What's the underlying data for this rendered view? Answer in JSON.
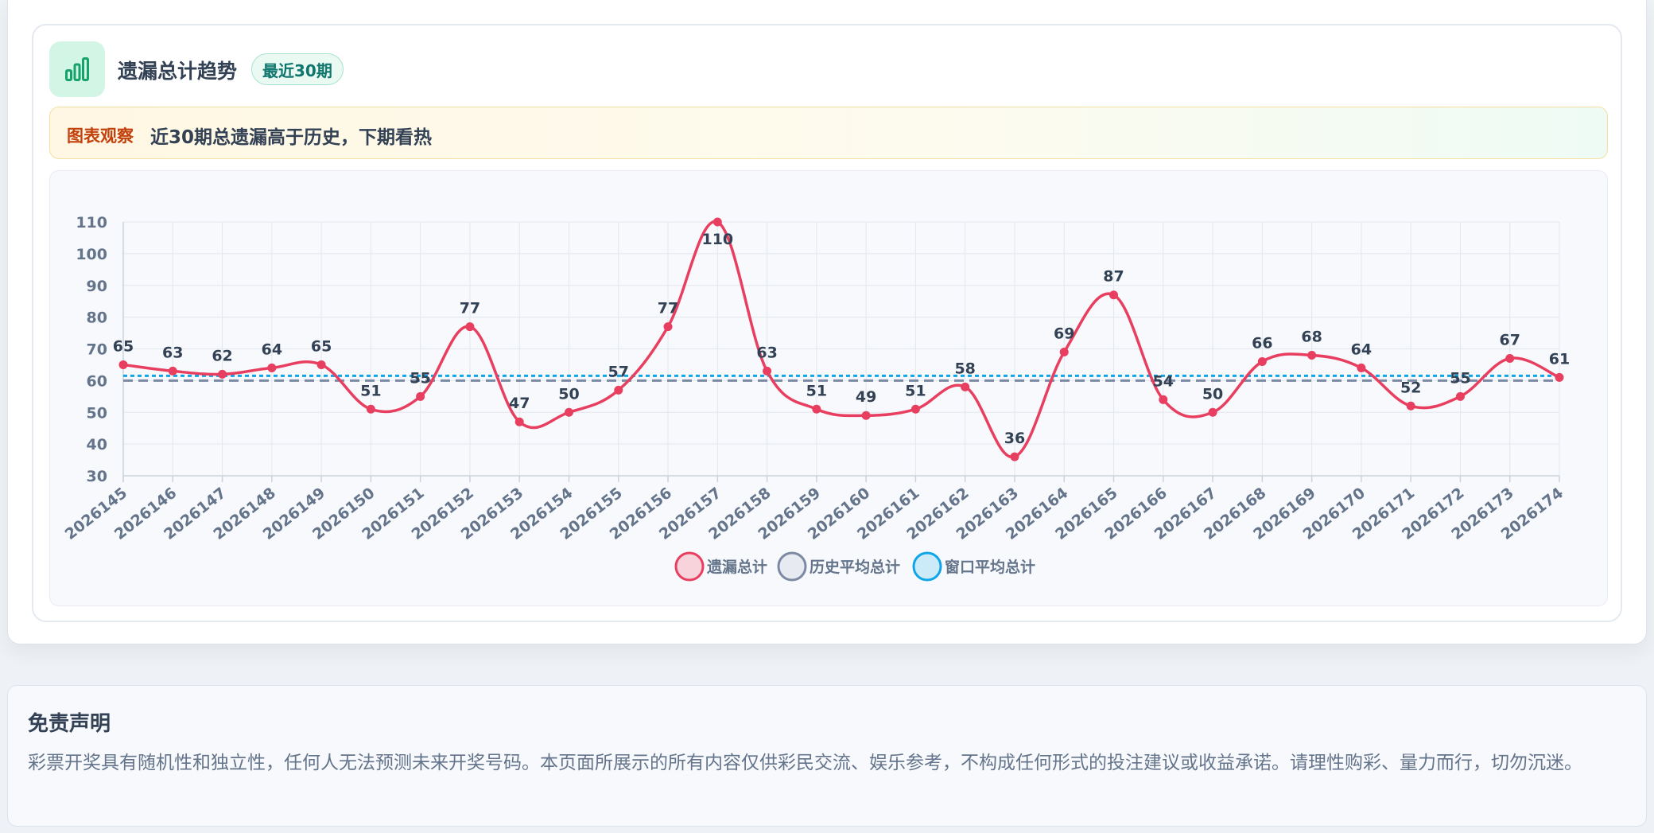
{
  "header": {
    "title": "遗漏总计趋势",
    "badge": "最近30期",
    "icon": "bar-chart-icon"
  },
  "observation": {
    "label": "图表观察",
    "text": "近30期总遗漏高于历史，下期看热"
  },
  "chart_data": {
    "type": "line",
    "categories": [
      "2026145",
      "2026146",
      "2026147",
      "2026148",
      "2026149",
      "2026150",
      "2026151",
      "2026152",
      "2026153",
      "2026154",
      "2026155",
      "2026156",
      "2026157",
      "2026158",
      "2026159",
      "2026160",
      "2026161",
      "2026162",
      "2026163",
      "2026164",
      "2026165",
      "2026166",
      "2026167",
      "2026168",
      "2026169",
      "2026170",
      "2026171",
      "2026172",
      "2026173",
      "2026174"
    ],
    "series": [
      {
        "name": "遗漏总计",
        "color": "#e83e5f",
        "style": "solid",
        "values": [
          65,
          63,
          62,
          64,
          65,
          51,
          55,
          77,
          47,
          50,
          57,
          77,
          110,
          63,
          51,
          49,
          51,
          58,
          36,
          69,
          87,
          54,
          50,
          66,
          68,
          64,
          52,
          55,
          67,
          61
        ]
      },
      {
        "name": "历史平均总计",
        "color": "#7b8aa2",
        "style": "dashed",
        "value": 60
      },
      {
        "name": "窗口平均总计",
        "color": "#0ea5e9",
        "style": "dotted",
        "value": 61.5
      }
    ],
    "y_ticks": [
      30,
      40,
      50,
      60,
      70,
      80,
      90,
      100,
      110
    ],
    "ylim": [
      30,
      110
    ],
    "grid": true,
    "legend_position": "bottom-center",
    "title": "",
    "xlabel": "",
    "ylabel": ""
  },
  "disclaimer": {
    "title": "免责声明",
    "text": "彩票开奖具有随机性和独立性，任何人无法预测未来开奖号码。本页面所展示的所有内容仅供彩民交流、娱乐参考，不构成任何形式的投注建议或收益承诺。请理性购彩、量力而行，切勿沉迷。"
  }
}
